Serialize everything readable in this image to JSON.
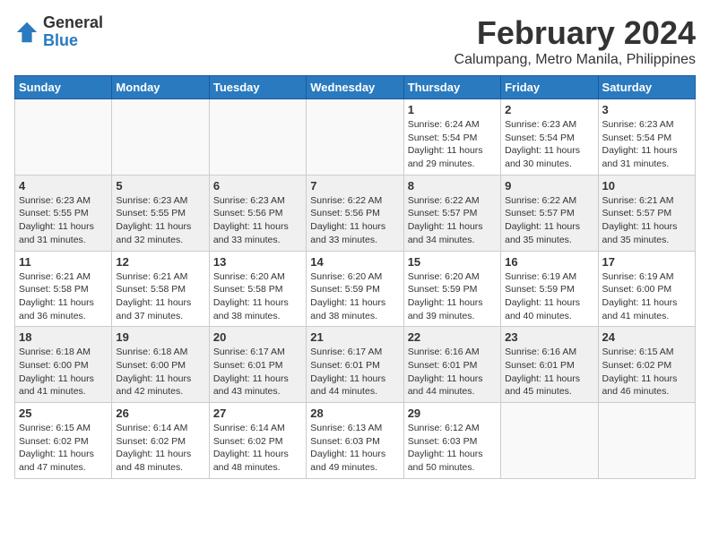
{
  "logo": {
    "general": "General",
    "blue": "Blue"
  },
  "title": "February 2024",
  "location": "Calumpang, Metro Manila, Philippines",
  "weekdays": [
    "Sunday",
    "Monday",
    "Tuesday",
    "Wednesday",
    "Thursday",
    "Friday",
    "Saturday"
  ],
  "weeks": [
    [
      {
        "day": "",
        "info": ""
      },
      {
        "day": "",
        "info": ""
      },
      {
        "day": "",
        "info": ""
      },
      {
        "day": "",
        "info": ""
      },
      {
        "day": "1",
        "info": "Sunrise: 6:24 AM\nSunset: 5:54 PM\nDaylight: 11 hours and 29 minutes."
      },
      {
        "day": "2",
        "info": "Sunrise: 6:23 AM\nSunset: 5:54 PM\nDaylight: 11 hours and 30 minutes."
      },
      {
        "day": "3",
        "info": "Sunrise: 6:23 AM\nSunset: 5:54 PM\nDaylight: 11 hours and 31 minutes."
      }
    ],
    [
      {
        "day": "4",
        "info": "Sunrise: 6:23 AM\nSunset: 5:55 PM\nDaylight: 11 hours and 31 minutes."
      },
      {
        "day": "5",
        "info": "Sunrise: 6:23 AM\nSunset: 5:55 PM\nDaylight: 11 hours and 32 minutes."
      },
      {
        "day": "6",
        "info": "Sunrise: 6:23 AM\nSunset: 5:56 PM\nDaylight: 11 hours and 33 minutes."
      },
      {
        "day": "7",
        "info": "Sunrise: 6:22 AM\nSunset: 5:56 PM\nDaylight: 11 hours and 33 minutes."
      },
      {
        "day": "8",
        "info": "Sunrise: 6:22 AM\nSunset: 5:57 PM\nDaylight: 11 hours and 34 minutes."
      },
      {
        "day": "9",
        "info": "Sunrise: 6:22 AM\nSunset: 5:57 PM\nDaylight: 11 hours and 35 minutes."
      },
      {
        "day": "10",
        "info": "Sunrise: 6:21 AM\nSunset: 5:57 PM\nDaylight: 11 hours and 35 minutes."
      }
    ],
    [
      {
        "day": "11",
        "info": "Sunrise: 6:21 AM\nSunset: 5:58 PM\nDaylight: 11 hours and 36 minutes."
      },
      {
        "day": "12",
        "info": "Sunrise: 6:21 AM\nSunset: 5:58 PM\nDaylight: 11 hours and 37 minutes."
      },
      {
        "day": "13",
        "info": "Sunrise: 6:20 AM\nSunset: 5:58 PM\nDaylight: 11 hours and 38 minutes."
      },
      {
        "day": "14",
        "info": "Sunrise: 6:20 AM\nSunset: 5:59 PM\nDaylight: 11 hours and 38 minutes."
      },
      {
        "day": "15",
        "info": "Sunrise: 6:20 AM\nSunset: 5:59 PM\nDaylight: 11 hours and 39 minutes."
      },
      {
        "day": "16",
        "info": "Sunrise: 6:19 AM\nSunset: 5:59 PM\nDaylight: 11 hours and 40 minutes."
      },
      {
        "day": "17",
        "info": "Sunrise: 6:19 AM\nSunset: 6:00 PM\nDaylight: 11 hours and 41 minutes."
      }
    ],
    [
      {
        "day": "18",
        "info": "Sunrise: 6:18 AM\nSunset: 6:00 PM\nDaylight: 11 hours and 41 minutes."
      },
      {
        "day": "19",
        "info": "Sunrise: 6:18 AM\nSunset: 6:00 PM\nDaylight: 11 hours and 42 minutes."
      },
      {
        "day": "20",
        "info": "Sunrise: 6:17 AM\nSunset: 6:01 PM\nDaylight: 11 hours and 43 minutes."
      },
      {
        "day": "21",
        "info": "Sunrise: 6:17 AM\nSunset: 6:01 PM\nDaylight: 11 hours and 44 minutes."
      },
      {
        "day": "22",
        "info": "Sunrise: 6:16 AM\nSunset: 6:01 PM\nDaylight: 11 hours and 44 minutes."
      },
      {
        "day": "23",
        "info": "Sunrise: 6:16 AM\nSunset: 6:01 PM\nDaylight: 11 hours and 45 minutes."
      },
      {
        "day": "24",
        "info": "Sunrise: 6:15 AM\nSunset: 6:02 PM\nDaylight: 11 hours and 46 minutes."
      }
    ],
    [
      {
        "day": "25",
        "info": "Sunrise: 6:15 AM\nSunset: 6:02 PM\nDaylight: 11 hours and 47 minutes."
      },
      {
        "day": "26",
        "info": "Sunrise: 6:14 AM\nSunset: 6:02 PM\nDaylight: 11 hours and 48 minutes."
      },
      {
        "day": "27",
        "info": "Sunrise: 6:14 AM\nSunset: 6:02 PM\nDaylight: 11 hours and 48 minutes."
      },
      {
        "day": "28",
        "info": "Sunrise: 6:13 AM\nSunset: 6:03 PM\nDaylight: 11 hours and 49 minutes."
      },
      {
        "day": "29",
        "info": "Sunrise: 6:12 AM\nSunset: 6:03 PM\nDaylight: 11 hours and 50 minutes."
      },
      {
        "day": "",
        "info": ""
      },
      {
        "day": "",
        "info": ""
      }
    ]
  ]
}
